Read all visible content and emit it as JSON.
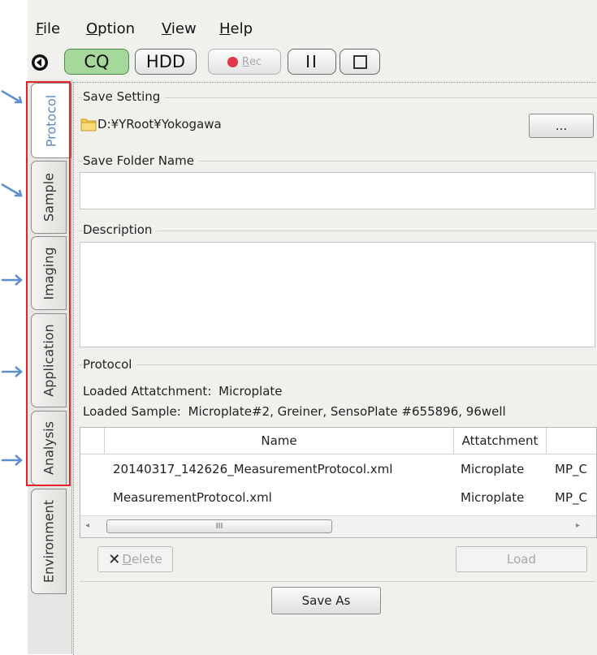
{
  "menu": {
    "file": {
      "u": "F",
      "rest": "ile"
    },
    "option": {
      "u": "O",
      "rest": "ption"
    },
    "view": {
      "u": "V",
      "rest": "iew"
    },
    "help": {
      "u": "H",
      "rest": "elp"
    }
  },
  "toolbar": {
    "cq": "CQ",
    "hdd": "HDD",
    "rec_u": "R",
    "rec_rest": "ec",
    "pause": "II"
  },
  "tabs": [
    {
      "label": "Protocol",
      "active": true
    },
    {
      "label": "Sample"
    },
    {
      "label": "Imaging"
    },
    {
      "label": "Application"
    },
    {
      "label": "Analysis"
    },
    {
      "label": "Environment"
    }
  ],
  "save_setting": {
    "title": "Save Setting",
    "path": "D:¥YRoot¥Yokogawa",
    "browse_label": "..."
  },
  "save_folder": {
    "title": "Save Folder Name",
    "value": ""
  },
  "description": {
    "title": "Description",
    "value": ""
  },
  "protocol": {
    "title": "Protocol",
    "loaded_attachment_label": "Loaded Attatchment:",
    "loaded_attachment_value": "Microplate",
    "loaded_sample_label": "Loaded Sample:",
    "loaded_sample_value": "Microplate#2, Greiner, SensoPlate #655896, 96well",
    "columns": [
      "Name",
      "Attatchment",
      ""
    ],
    "rows": [
      {
        "name": "20140317_142626_MeasurementProtocol.xml",
        "attachment": "Microplate",
        "extra": "MP_C"
      },
      {
        "name": "MeasurementProtocol.xml",
        "attachment": "Microplate",
        "extra": "MP_C"
      }
    ],
    "scroll_grip": "III",
    "delete_u": "D",
    "delete_rest": "elete",
    "load_label": "Load",
    "save_as_label": "Save As"
  },
  "colors": {
    "accent": "#e2232a",
    "cq_green": "#a6d79b",
    "arrow_blue": "#5b8fd0",
    "rec_red": "#e0374a"
  }
}
